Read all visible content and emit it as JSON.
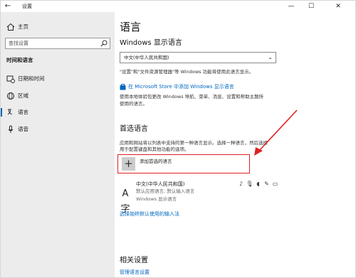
{
  "window": {
    "title": "设置",
    "back_glyph": "←",
    "minimize_glyph": "—",
    "maximize_glyph": "☐",
    "close_glyph": "✕"
  },
  "sidebar": {
    "home_label": "主页",
    "search_placeholder": "查找设置",
    "section_title": "时间和语言",
    "items": [
      {
        "label": "日期和时间",
        "icon": "calendar-clock-icon"
      },
      {
        "label": "区域",
        "icon": "globe-icon"
      },
      {
        "label": "语言",
        "icon": "language-icon",
        "selected": true
      },
      {
        "label": "语音",
        "icon": "microphone-icon"
      }
    ]
  },
  "main": {
    "page_title": "语言",
    "display_language": {
      "heading": "Windows 显示语言",
      "selected_value": "中文(中华人民共和国)",
      "note": "\"设置\"和\"文件资源管理器\"等 Windows 功能将使用此语言显示。"
    },
    "store": {
      "link_text": "在 Microsoft Store 中添加 Windows 显示语言",
      "description_line1": "使用本地体验包更改 Windows 导航、菜单、消息、设置和帮助主题所",
      "description_line2": "使用的语言。"
    },
    "preferred": {
      "heading": "首选语言",
      "description_line1": "应用和网站将以列表中支持的第一种语言显示。选择一种语言，然后选择",
      "description_line2": "用于配置键盘和其他功能的选项。",
      "add_label": "添加首选的语言",
      "add_glyph": "+",
      "language": {
        "name": "中文(中华人民共和国)",
        "line2": "默认应用语言; 默认输入语言",
        "line3": "Windows 显示语言",
        "icon_glyph": "A字"
      },
      "input_method_link": "选择始终默认使用的输入法"
    },
    "related": {
      "heading": "相关设置",
      "link": "管理语言设置"
    }
  },
  "colors": {
    "accent": "#0067c0",
    "highlight": "#e02020",
    "sidebar_bg": "#ececec"
  }
}
